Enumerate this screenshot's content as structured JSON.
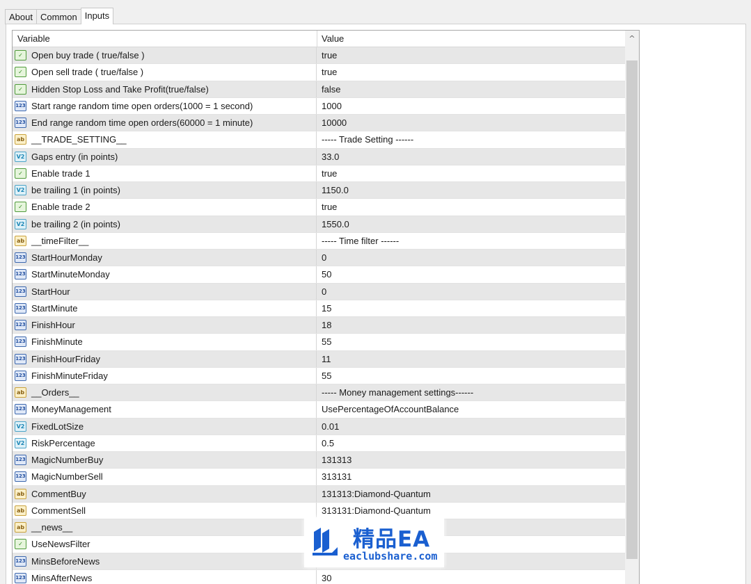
{
  "tabs": [
    {
      "label": "About"
    },
    {
      "label": "Common"
    },
    {
      "label": "Inputs"
    }
  ],
  "active_tab": "Inputs",
  "table": {
    "columns": {
      "variable": "Variable",
      "value": "Value"
    },
    "rows": [
      {
        "type": "bool",
        "icon": "bool-icon",
        "variable": "Open buy trade ( true/false )",
        "value": "true"
      },
      {
        "type": "bool",
        "icon": "bool-icon",
        "variable": "Open sell trade ( true/false )",
        "value": "true"
      },
      {
        "type": "bool",
        "icon": "bool-icon",
        "variable": "Hidden Stop Loss and Take Profit(true/false)",
        "value": "false"
      },
      {
        "type": "int",
        "icon": "integer-icon",
        "variable": "Start range random time open orders(1000 = 1 second)",
        "value": "1000"
      },
      {
        "type": "int",
        "icon": "integer-icon",
        "variable": "End range random time open orders(60000 = 1 minute)",
        "value": "10000"
      },
      {
        "type": "str",
        "icon": "string-icon",
        "variable": "__TRADE_SETTING__",
        "value": "----- Trade Setting ------"
      },
      {
        "type": "dbl",
        "icon": "double-icon",
        "variable": "Gaps entry (in points)",
        "value": "33.0"
      },
      {
        "type": "bool",
        "icon": "bool-icon",
        "variable": "Enable trade 1",
        "value": "true"
      },
      {
        "type": "dbl",
        "icon": "double-icon",
        "variable": "be trailing 1 (in points)",
        "value": "1150.0"
      },
      {
        "type": "bool",
        "icon": "bool-icon",
        "variable": "Enable trade 2",
        "value": "true"
      },
      {
        "type": "dbl",
        "icon": "double-icon",
        "variable": "be trailing 2 (in points)",
        "value": "1550.0"
      },
      {
        "type": "str",
        "icon": "string-icon",
        "variable": "__timeFilter__",
        "value": "----- Time filter ------"
      },
      {
        "type": "int",
        "icon": "integer-icon",
        "variable": "StartHourMonday",
        "value": "0"
      },
      {
        "type": "int",
        "icon": "integer-icon",
        "variable": "StartMinuteMonday",
        "value": "50"
      },
      {
        "type": "int",
        "icon": "integer-icon",
        "variable": "StartHour",
        "value": "0"
      },
      {
        "type": "int",
        "icon": "integer-icon",
        "variable": "StartMinute",
        "value": "15"
      },
      {
        "type": "int",
        "icon": "integer-icon",
        "variable": "FinishHour",
        "value": "18"
      },
      {
        "type": "int",
        "icon": "integer-icon",
        "variable": "FinishMinute",
        "value": "55"
      },
      {
        "type": "int",
        "icon": "integer-icon",
        "variable": "FinishHourFriday",
        "value": "11"
      },
      {
        "type": "int",
        "icon": "integer-icon",
        "variable": "FinishMinuteFriday",
        "value": "55"
      },
      {
        "type": "str",
        "icon": "string-icon",
        "variable": "__Orders__",
        "value": "----- Money management settings------"
      },
      {
        "type": "int",
        "icon": "integer-icon",
        "variable": "MoneyManagement",
        "value": "UsePercentageOfAccountBalance"
      },
      {
        "type": "dbl",
        "icon": "double-icon",
        "variable": "FixedLotSize",
        "value": "0.01"
      },
      {
        "type": "dbl",
        "icon": "double-icon",
        "variable": "RiskPercentage",
        "value": "0.5"
      },
      {
        "type": "int",
        "icon": "integer-icon",
        "variable": "MagicNumberBuy",
        "value": "131313"
      },
      {
        "type": "int",
        "icon": "integer-icon",
        "variable": "MagicNumberSell",
        "value": "313131"
      },
      {
        "type": "str",
        "icon": "string-icon",
        "variable": "CommentBuy",
        "value": "131313:Diamond-Quantum"
      },
      {
        "type": "str",
        "icon": "string-icon",
        "variable": "CommentSell",
        "value": "313131:Diamond-Quantum"
      },
      {
        "type": "str",
        "icon": "string-icon",
        "variable": "__news__",
        "value": ""
      },
      {
        "type": "bool",
        "icon": "bool-icon",
        "variable": "UseNewsFilter",
        "value": ""
      },
      {
        "type": "int",
        "icon": "integer-icon",
        "variable": "MinsBeforeNews",
        "value": ""
      },
      {
        "type": "int",
        "icon": "integer-icon",
        "variable": "MinsAfterNews",
        "value": "30"
      }
    ]
  },
  "icon_text": {
    "bool": "✓",
    "int": "123",
    "dbl": "V2",
    "str": "ab"
  },
  "scrollbar": {
    "up_arrow": "^"
  },
  "watermark": {
    "title": "精品EA",
    "subtitle": "eaclubshare.com"
  }
}
